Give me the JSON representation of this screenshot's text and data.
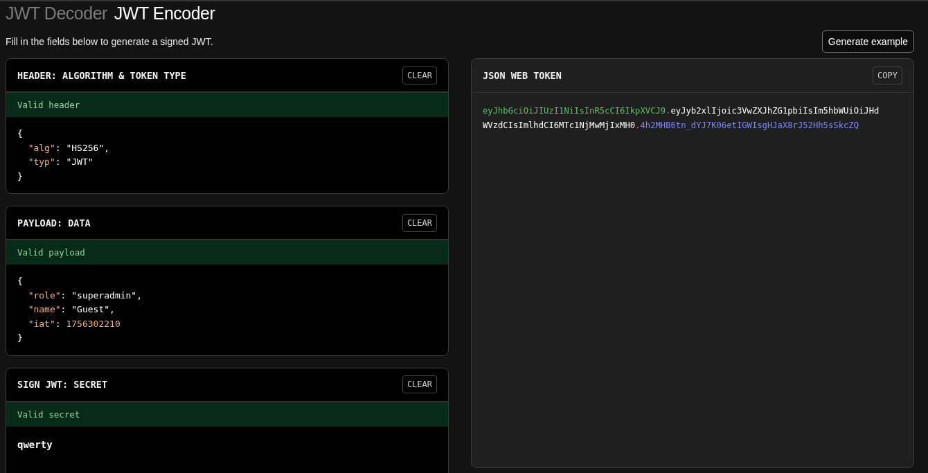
{
  "tabs": [
    {
      "label": "JWT Decoder",
      "selected": false
    },
    {
      "label": "JWT Encoder",
      "selected": true
    }
  ],
  "subtitle": "Fill in the fields below to generate a signed JWT.",
  "generate_button": "Generate example",
  "panels": [
    {
      "title": "HEADER: ALGORITHM & TOKEN TYPE",
      "button": "CLEAR",
      "status": "Valid header",
      "valid": true,
      "kind": "code",
      "open": "{",
      "entries": [
        [
          {
            "kind": "key",
            "text": "\"alg\""
          },
          {
            "kind": "punct",
            "text": ": "
          },
          {
            "kind": "string",
            "text": "\"HS256\""
          },
          {
            "kind": "punct",
            "text": ","
          }
        ],
        [
          {
            "kind": "key",
            "text": "\"typ\""
          },
          {
            "kind": "punct",
            "text": ": "
          },
          {
            "kind": "string",
            "text": "\"JWT\""
          }
        ]
      ],
      "close": "}"
    },
    {
      "title": "PAYLOAD: DATA",
      "button": "CLEAR",
      "status": "Valid payload",
      "valid": true,
      "kind": "code",
      "open": "{",
      "entries": [
        [
          {
            "kind": "key",
            "text": "\"role\""
          },
          {
            "kind": "punct",
            "text": ": "
          },
          {
            "kind": "string",
            "text": "\"superadmin\""
          },
          {
            "kind": "punct",
            "text": ","
          }
        ],
        [
          {
            "kind": "key",
            "text": "\"name\""
          },
          {
            "kind": "punct",
            "text": ": "
          },
          {
            "kind": "string",
            "text": "\"Guest\""
          },
          {
            "kind": "punct",
            "text": ","
          }
        ],
        [
          {
            "kind": "key",
            "text": "\"iat\""
          },
          {
            "kind": "punct",
            "text": ": "
          },
          {
            "kind": "number",
            "text": "1756302210"
          }
        ]
      ],
      "close": "}"
    },
    {
      "title": "SIGN JWT: SECRET",
      "button": "CLEAR",
      "status": "Valid secret",
      "valid": true,
      "kind": "secret",
      "value": "qwerty"
    }
  ],
  "token_panel": {
    "title": "JSON WEB TOKEN",
    "button": "COPY",
    "parts": [
      {
        "kind": "header",
        "text": "eyJhbGciOiJIUzI1NiIsInR5cCI6IkpXVCJ9"
      },
      {
        "kind": "dot",
        "text": "."
      },
      {
        "kind": "payload",
        "text": "eyJyb2xlIjoic3VwZXJhZG1pbiIsIm5hbWUiOiJHdWVzdCIsImlhdCI6MTc1NjMwMjIxMH0"
      },
      {
        "kind": "dot",
        "text": "."
      },
      {
        "kind": "signature",
        "text": "4h2MHB6tn_dYJ7K06etIGWIsgHJaX8rJ52Hh5sSkcZQ"
      }
    ]
  }
}
